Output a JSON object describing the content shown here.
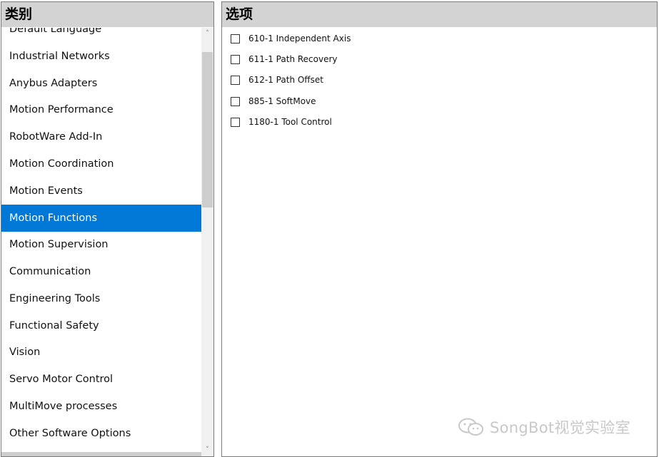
{
  "left_panel": {
    "header": "类别",
    "partial_top_item": "Default Language",
    "items": [
      {
        "label": "Industrial Networks",
        "selected": false
      },
      {
        "label": "Anybus Adapters",
        "selected": false
      },
      {
        "label": "Motion Performance",
        "selected": false
      },
      {
        "label": "RobotWare Add-In",
        "selected": false
      },
      {
        "label": "Motion Coordination",
        "selected": false
      },
      {
        "label": "Motion Events",
        "selected": false
      },
      {
        "label": "Motion Functions",
        "selected": true
      },
      {
        "label": "Motion Supervision",
        "selected": false
      },
      {
        "label": "Communication",
        "selected": false
      },
      {
        "label": "Engineering Tools",
        "selected": false
      },
      {
        "label": "Functional Safety",
        "selected": false
      },
      {
        "label": "Vision",
        "selected": false
      },
      {
        "label": "Servo Motor Control",
        "selected": false
      },
      {
        "label": "MultiMove processes",
        "selected": false
      },
      {
        "label": "Other Software Options",
        "selected": false
      }
    ]
  },
  "right_panel": {
    "header": "选项",
    "options": [
      {
        "label": "610-1 Independent Axis",
        "checked": false
      },
      {
        "label": "611-1 Path Recovery",
        "checked": false
      },
      {
        "label": "612-1 Path Offset",
        "checked": false
      },
      {
        "label": "885-1 SoftMove",
        "checked": false
      },
      {
        "label": "1180-1 Tool Control",
        "checked": false
      }
    ]
  },
  "watermark": {
    "text": "SongBot视觉实验室",
    "icon": "wechat-icon"
  },
  "colors": {
    "selection": "#0078d7",
    "header_bg": "#d3d3d3"
  }
}
